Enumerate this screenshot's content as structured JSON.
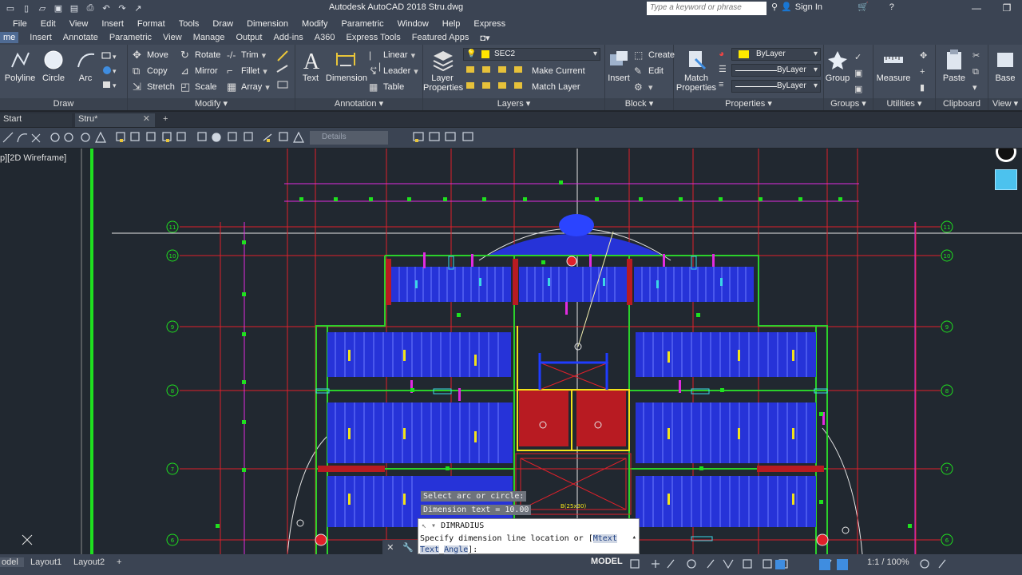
{
  "window": {
    "title": "Autodesk AutoCAD 2018   Stru.dwg",
    "search_placeholder": "Type a keyword or phrase",
    "sign_in": "Sign In",
    "controls": [
      "—",
      "❐"
    ]
  },
  "menu": [
    "File",
    "Edit",
    "View",
    "Insert",
    "Format",
    "Tools",
    "Draw",
    "Dimension",
    "Modify",
    "Parametric",
    "Window",
    "Help",
    "Express"
  ],
  "ribbon_tabs": [
    "me",
    "Insert",
    "Annotate",
    "Parametric",
    "View",
    "Manage",
    "Output",
    "Add-ins",
    "A360",
    "Express Tools",
    "Featured Apps"
  ],
  "panels": {
    "draw": {
      "label": "Draw",
      "tools": [
        "Polyline",
        "Circle",
        "Arc"
      ]
    },
    "modify": {
      "label": "Modify",
      "tools": [
        "Move",
        "Rotate",
        "Trim",
        "Copy",
        "Mirror",
        "Fillet",
        "Stretch",
        "Scale",
        "Array"
      ]
    },
    "annotation": {
      "label": "Annotation",
      "big": [
        "Text",
        "Dimension"
      ],
      "small": [
        "Linear",
        "Leader",
        "Table"
      ]
    },
    "layers": {
      "label": "Layers",
      "big": "Layer Properties",
      "layer_name": "SEC2",
      "small": [
        "Make Current",
        "Match Layer"
      ]
    },
    "block": {
      "label": "Block",
      "big": "Insert",
      "small": [
        "Create",
        "Edit"
      ]
    },
    "properties": {
      "label": "Properties",
      "big": "Match Properties",
      "values": [
        "ByLayer",
        "ByLayer",
        "ByLayer"
      ]
    },
    "groups": {
      "label": "Groups",
      "big": "Group"
    },
    "utilities": {
      "label": "Utilities",
      "big": "Measure"
    },
    "clipboard": {
      "label": "Clipboard",
      "big": "Paste"
    },
    "view": {
      "label": "View",
      "big": "Base"
    }
  },
  "file_tabs": [
    "Start",
    "Stru*"
  ],
  "details_placeholder": "Details",
  "viewport_label": "p][2D Wireframe]",
  "grid_labels": [
    "11",
    "10",
    "9",
    "8",
    "7",
    "6"
  ],
  "drawing_annotation": "B(25x30)",
  "command": {
    "tip1": "Select arc or circle:",
    "tip2": "Dimension text = 10.00",
    "history": "DIMRADIUS",
    "prompt_prefix": "Specify dimension line location or [",
    "opt_mtext": "Mtext",
    "opt_text": "Text",
    "opt_angle": "Angle",
    "prompt_suffix": "]:"
  },
  "status": {
    "tabs": [
      "odel",
      "Layout1",
      "Layout2"
    ],
    "model": "MODEL",
    "scale": "1:1 / 100%"
  },
  "colors": {
    "chrome": "#3b4453",
    "canvas": "#212830",
    "grid_red": "#e0202a",
    "wall_green": "#2bd12b",
    "slab_blue": "#2633d8",
    "magenta": "#e12ce0",
    "yellow": "#f2e21a"
  }
}
